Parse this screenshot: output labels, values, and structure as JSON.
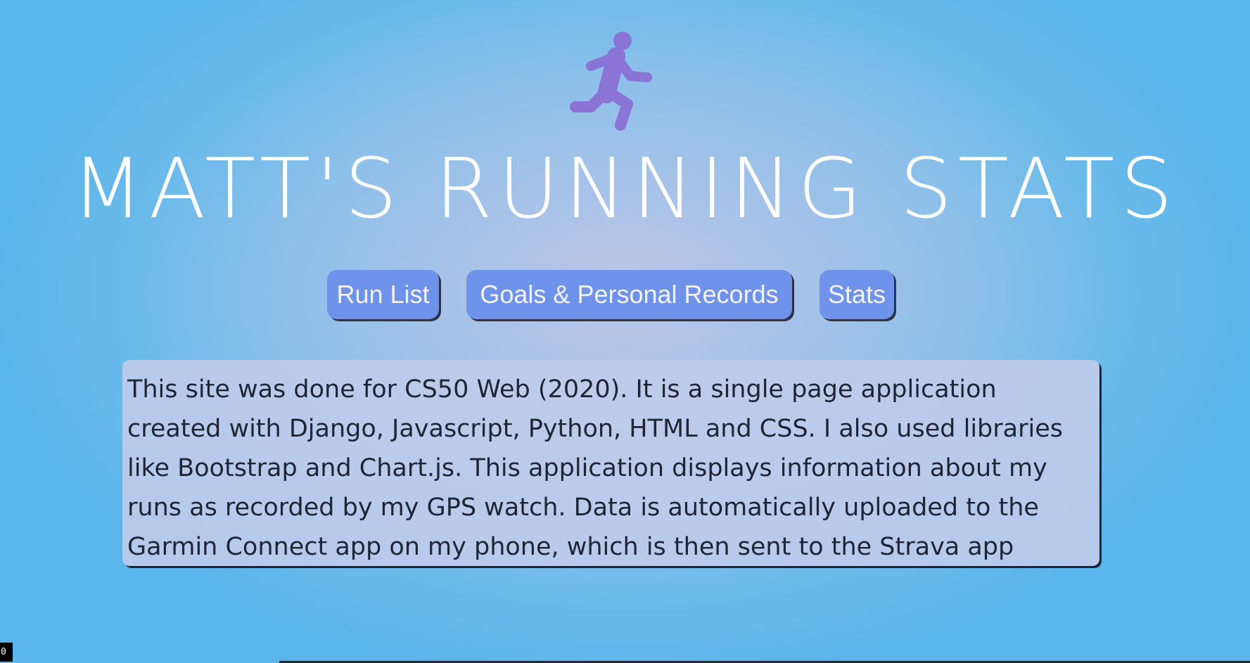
{
  "header": {
    "logo_icon": "running-person-icon",
    "title": "MATT'S RUNNING STATS"
  },
  "nav": {
    "run_list_label": "Run List",
    "goals_label": "Goals & Personal Records",
    "stats_label": "Stats"
  },
  "about": {
    "text": "This site was done for CS50 Web (2020). It is a single page application created with Django, Javascript, Python, HTML and CSS. I also used libraries like Bootstrap and Chart.js. This application displays information about my runs as recorded by my GPS watch. Data is automatically uploaded to the Garmin Connect app on my phone, which is then sent to the Strava app where I then access the data via API."
  },
  "corner_badge": "0",
  "colors": {
    "logo": "#8a74d6",
    "title": "#ffffff",
    "button_bg": "#6f93ea",
    "button_text": "#f4f2fb",
    "about_bg": "#c2ccea",
    "about_text": "#1f2535",
    "background_outer": "#5ab5ea",
    "background_center": "#bcc6e6"
  }
}
